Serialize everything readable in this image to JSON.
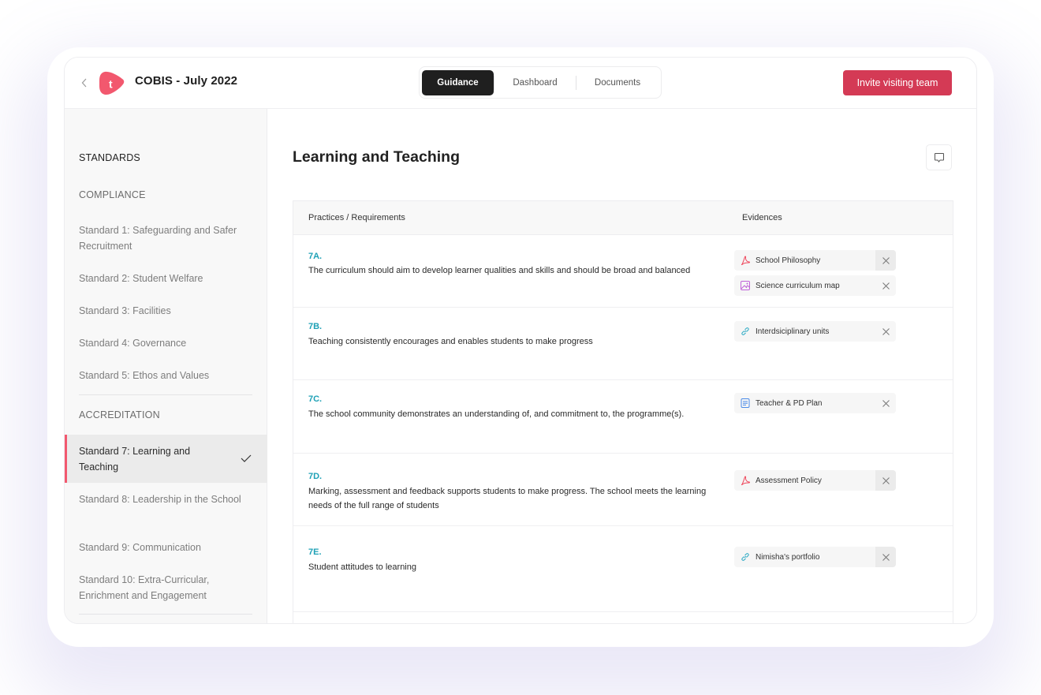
{
  "header": {
    "back_icon": "chevron-left-icon",
    "logo_letter": "t",
    "title": "COBIS - July 2022",
    "tabs": [
      {
        "label": "Guidance",
        "active": true
      },
      {
        "label": "Dashboard",
        "active": false
      },
      {
        "label": "Documents",
        "active": false
      }
    ],
    "invite_button": "Invite visiting team"
  },
  "colors": {
    "brand": "#f2586e",
    "accent_button": "#d43a55",
    "code_teal": "#1ea1b6",
    "active_tab": "#1f1f1f"
  },
  "sidebar": {
    "heading": "STANDARDS",
    "sections": [
      {
        "title": "COMPLIANCE",
        "items": [
          {
            "label": "Standard 1: Safeguarding and Safer Recruitment",
            "active": false
          },
          {
            "label": "Standard 2: Student Welfare",
            "active": false
          },
          {
            "label": "Standard 3: Facilities",
            "active": false
          },
          {
            "label": "Standard 4: Governance",
            "active": false
          },
          {
            "label": "Standard 5: Ethos and Values",
            "active": false
          }
        ]
      },
      {
        "title": "ACCREDITATION",
        "items": [
          {
            "label": "Standard 7: Learning and Teaching",
            "active": true,
            "icon": "checkmark-icon"
          },
          {
            "label": "Standard 8: Leadership in the School",
            "active": false
          },
          {
            "label": "Standard 9: Communication",
            "active": false
          },
          {
            "label": "Standard 10: Extra-Curricular, Enrichment and Engagement",
            "active": false
          }
        ]
      }
    ]
  },
  "main": {
    "title": "Learning and Teaching",
    "comment_icon": "comment-icon",
    "table": {
      "columns": [
        "Practices / Requirements",
        "Evidences"
      ],
      "rows": [
        {
          "code": "7A.",
          "description": "The curriculum should aim to develop learner qualities and skills and should be broad and balanced",
          "evidences": [
            {
              "name": "School Philosophy",
              "type": "pdf-icon"
            },
            {
              "name": "Science curriculum map",
              "type": "image-icon"
            }
          ]
        },
        {
          "code": "7B.",
          "description": "Teaching consistently encourages and enables students to make progress",
          "evidences": [
            {
              "name": "Interdsiciplinary units",
              "type": "link-icon"
            }
          ]
        },
        {
          "code": "7C.",
          "description": "The school community demonstrates an understanding of, and commitment to, the programme(s).",
          "evidences": [
            {
              "name": "Teacher & PD Plan",
              "type": "document-icon"
            }
          ]
        },
        {
          "code": "7D.",
          "description": "Marking, assessment and feedback supports students to make progress. The school meets the learning needs of the full range of students",
          "evidences": [
            {
              "name": "Assessment Policy",
              "type": "pdf-icon"
            }
          ]
        },
        {
          "code": "7E.",
          "description": "Student attitudes to learning",
          "evidences": [
            {
              "name": "Nimisha's portfolio",
              "type": "link-icon"
            }
          ]
        }
      ]
    }
  }
}
